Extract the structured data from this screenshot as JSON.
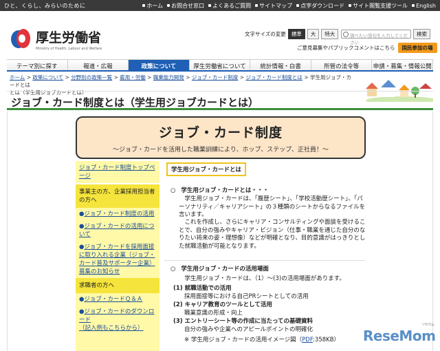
{
  "topbar": {
    "tagline": "ひと、くらし、みらいのために",
    "links": [
      "ホーム",
      "お問合せ窓口",
      "よくあるご質問",
      "サイトマップ",
      "点字ダウンロード",
      "サイト閲覧支援ツール",
      "English"
    ]
  },
  "header": {
    "logo_jp": "厚生労働省",
    "logo_en": "Ministry of Health, Labour and Welfare",
    "font_size_label": "文字サイズの変更",
    "font_sizes": [
      "標準",
      "大",
      "特大"
    ],
    "search_placeholder": "調べたい語句を入力してください",
    "search_button": "検索",
    "opinion_text": "ご意見募集やパブリックコメントはこちら",
    "opinion_button": "国民参加の場"
  },
  "nav": {
    "items": [
      "テーマ別に探す",
      "報道・広報",
      "政策について",
      "厚生労働省について",
      "統計情報・白書",
      "所管の法令等",
      "申請・募集・情報公開"
    ],
    "active_index": 2
  },
  "breadcrumb": {
    "links": [
      "ホーム",
      "政策について",
      "分野別の政策一覧",
      "雇用・労働",
      "職業能力開発",
      "ジョブ・カード制度",
      "ジョブ・カード制度とは"
    ],
    "current_part1": "学生用ジョブ・カードとは",
    "current_part2": "とは（学生用ジョブカードとは）"
  },
  "page_title": "ジョブ・カード制度とは（学生用ジョブカードとは）",
  "banner": {
    "heading": "ジョブ・カード制度",
    "subheading": "～ジョブ・カードを活用した職業訓練により、ホップ、ステップ、正社員！～"
  },
  "sidebar": {
    "top_link": "ジョブ・カード制度トップページ",
    "employer_heading": "事業主の方、企業採用担当者の方へ",
    "employer_links": [
      "ジョブ・カード制度の活用",
      "ジョブ・カードの活用について",
      "ジョブ・カードを採用面接に取り入れる企業（ジョブ・カード普及サポーター企業）募集のお知らせ"
    ],
    "jobseeker_heading": "求職者の方へ",
    "jobseeker_links": [
      "ジョブ・カードＱ＆Ａ",
      "ジョブ・カードのダウンロード",
      "（記入例もこちらから）"
    ]
  },
  "main": {
    "tab": "学生用ジョブ・カードとは",
    "section1_title": "学生用ジョブ・カードとは・・・",
    "section1_para1": "学生用ジョブ・カードは、「履歴シート」、「学校活動歴シート」、「パーソナリティ／キャリアシート」の３種類のシートからなるファイルを言います。",
    "section1_para2": "これを作成し、さらにキャリア・コンサルティングや面談を受けることで、自分の強みやキャリア・ビジョン（仕事・職業を通じた自分のなりたい将来の姿・理想像）などが明確となり、目的意識がはっきりとした就職活動が可能となります。",
    "section2_title": "学生用ジョブ・カードの活用場面",
    "section2_intro": "学生用ジョブ・カードは、（1）～(3)の活用場面があります。",
    "uses": [
      {
        "title": "(1) 就職活動での活用",
        "desc": "採用面接等における自己PRシートとしての活用"
      },
      {
        "title": "(2) キャリア教育のツールとして活用",
        "desc": "職業意識の形成・向上"
      },
      {
        "title": "(3) エントリーシート等の作成に当たっての基礎資料",
        "desc": "自分の強みや企業へのアピールポイントの明確化"
      }
    ],
    "pdf_note_prefix": "※ 学生用ジョブ・カードの活用イメージ図（",
    "pdf_link": "PDF",
    "pdf_note_suffix": ":358KB）"
  },
  "watermark": {
    "brand": "ReseMom",
    "small": "リセマム"
  },
  "colors": {
    "nav_active": "#1f5fb5",
    "title_rule": "#3b8f3b",
    "banner_bg": "#fde5c8",
    "sidebar_bg": "#fff9a8",
    "sidebar_head": "#f5e43b",
    "opinion_btn": "#f39a1c"
  }
}
